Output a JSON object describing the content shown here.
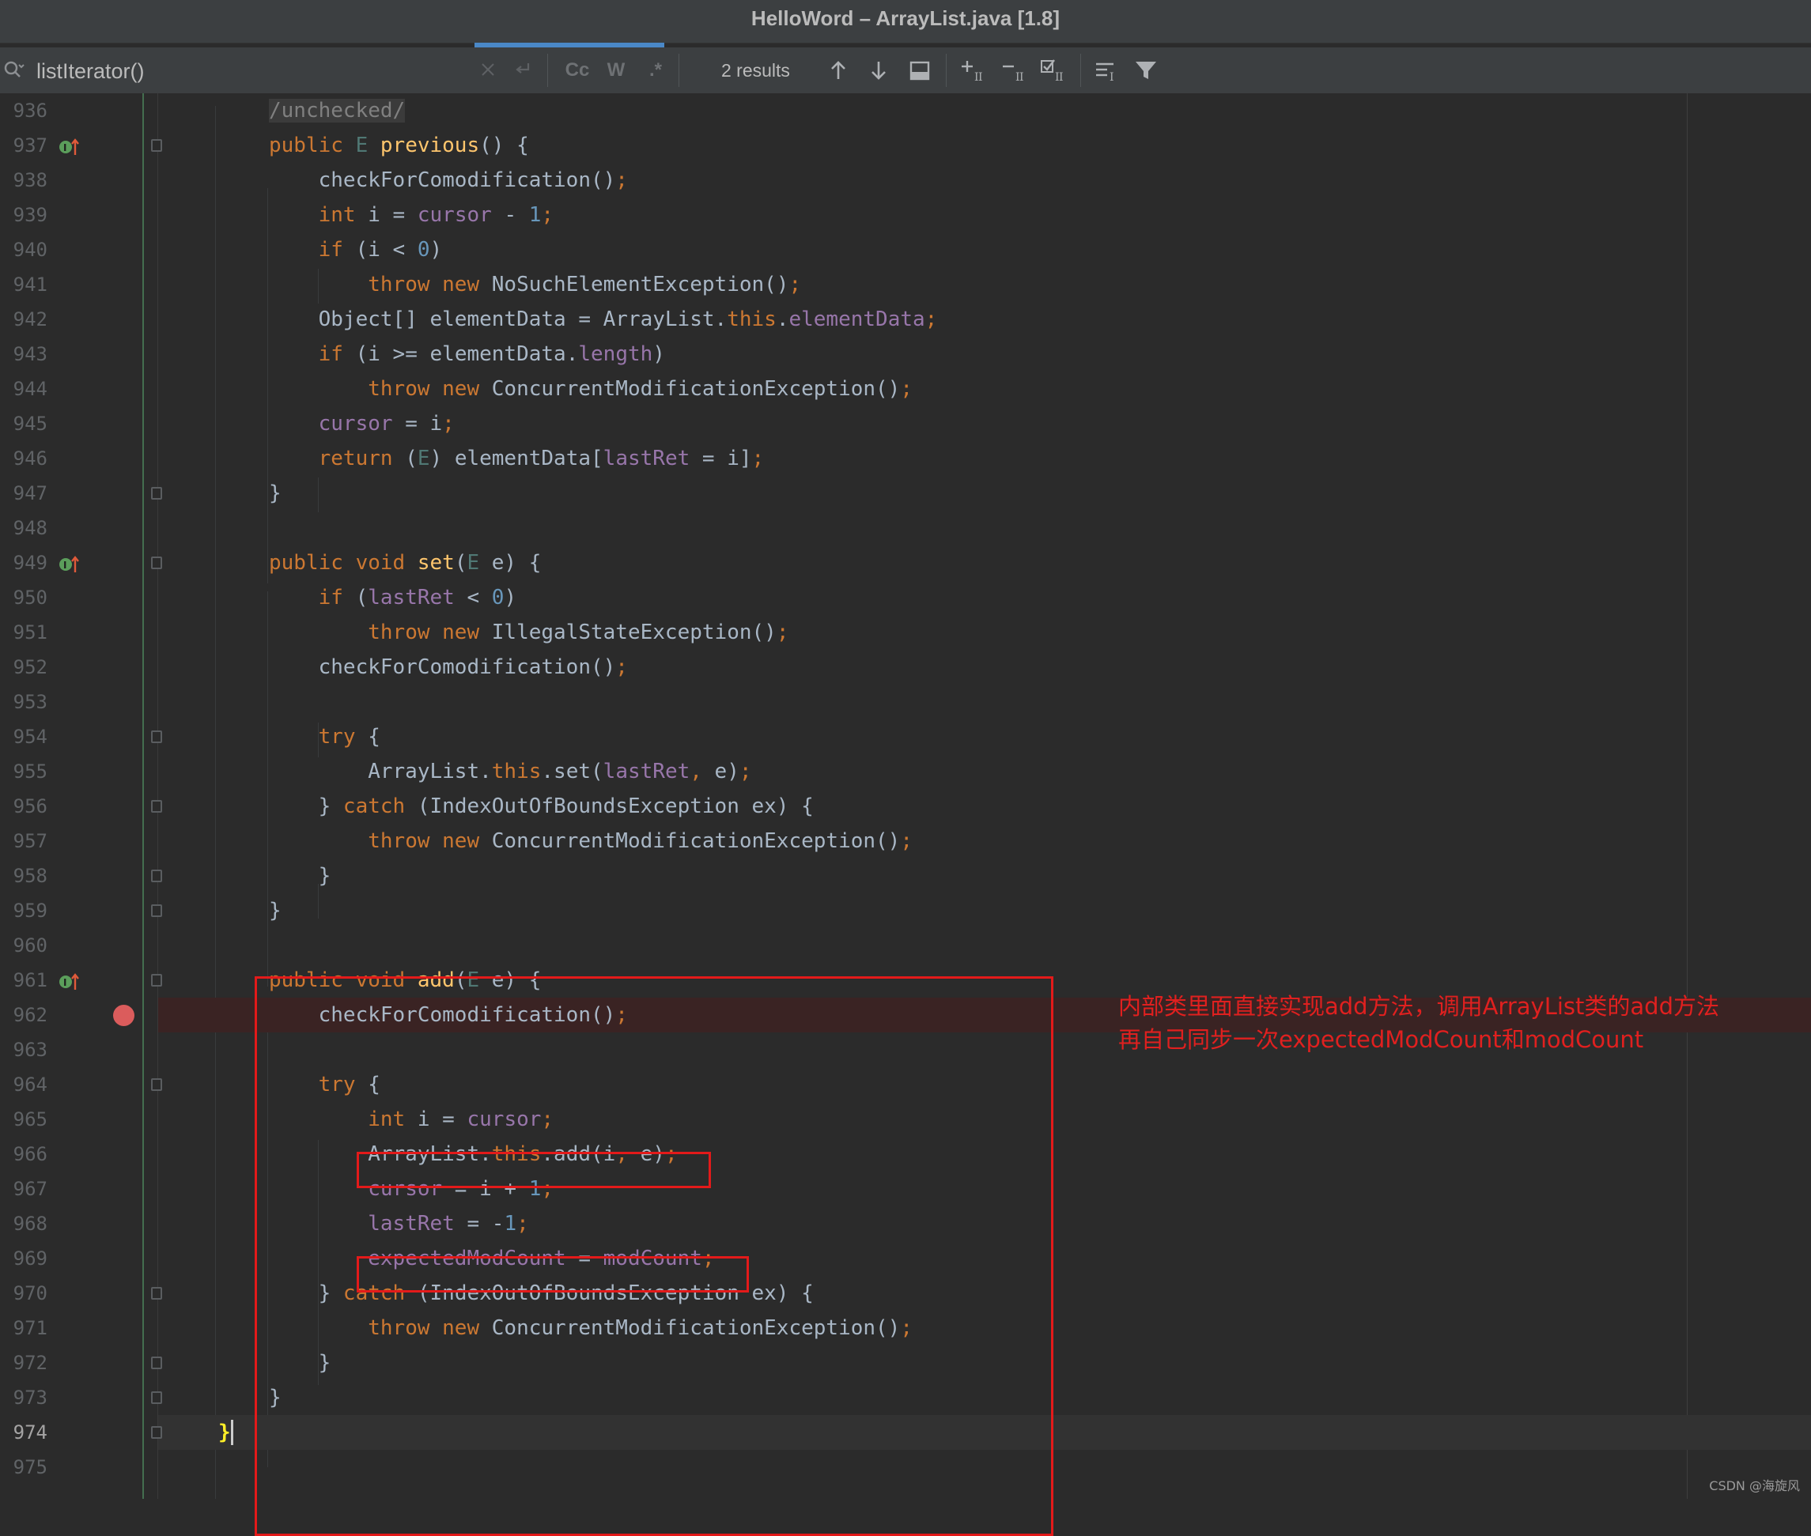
{
  "window": {
    "title": "HelloWord – ArrayList.java [1.8]"
  },
  "find_bar": {
    "query": "listIterator()",
    "match_case_label": "Cc",
    "words_label": "W",
    "regex_label": ".*",
    "results": "2 results"
  },
  "code_lines": [
    {
      "n": "936",
      "t": "/unchecked/"
    },
    {
      "n": "937",
      "t": "public E previous() {"
    },
    {
      "n": "938",
      "t": "checkForComodification();"
    },
    {
      "n": "939",
      "t": "int i = cursor - 1;"
    },
    {
      "n": "940",
      "t": "if (i < 0)"
    },
    {
      "n": "941",
      "t": "throw new NoSuchElementException();"
    },
    {
      "n": "942",
      "t": "Object[] elementData = ArrayList.this.elementData;"
    },
    {
      "n": "943",
      "t": "if (i >= elementData.length)"
    },
    {
      "n": "944",
      "t": "throw new ConcurrentModificationException();"
    },
    {
      "n": "945",
      "t": "cursor = i;"
    },
    {
      "n": "946",
      "t": "return (E) elementData[lastRet = i];"
    },
    {
      "n": "947",
      "t": "}"
    },
    {
      "n": "948",
      "t": ""
    },
    {
      "n": "949",
      "t": "public void set(E e) {"
    },
    {
      "n": "950",
      "t": "if (lastRet < 0)"
    },
    {
      "n": "951",
      "t": "throw new IllegalStateException();"
    },
    {
      "n": "952",
      "t": "checkForComodification();"
    },
    {
      "n": "953",
      "t": ""
    },
    {
      "n": "954",
      "t": "try {"
    },
    {
      "n": "955",
      "t": "ArrayList.this.set(lastRet, e);"
    },
    {
      "n": "956",
      "t": "} catch (IndexOutOfBoundsException ex) {"
    },
    {
      "n": "957",
      "t": "throw new ConcurrentModificationException();"
    },
    {
      "n": "958",
      "t": "}"
    },
    {
      "n": "959",
      "t": "}"
    },
    {
      "n": "960",
      "t": ""
    },
    {
      "n": "961",
      "t": "public void add(E e) {"
    },
    {
      "n": "962",
      "t": "checkForComodification();"
    },
    {
      "n": "963",
      "t": ""
    },
    {
      "n": "964",
      "t": "try {"
    },
    {
      "n": "965",
      "t": "int i = cursor;"
    },
    {
      "n": "966",
      "t": "ArrayList.this.add(i, e);"
    },
    {
      "n": "967",
      "t": "cursor = i + 1;"
    },
    {
      "n": "968",
      "t": "lastRet = -1;"
    },
    {
      "n": "969",
      "t": "expectedModCount = modCount;"
    },
    {
      "n": "970",
      "t": "} catch (IndexOutOfBoundsException ex) {"
    },
    {
      "n": "971",
      "t": "throw new ConcurrentModificationException();"
    },
    {
      "n": "972",
      "t": "}"
    },
    {
      "n": "973",
      "t": "}"
    },
    {
      "n": "974",
      "t": "}"
    },
    {
      "n": "975",
      "t": ""
    }
  ],
  "annotation": {
    "line1": "内部类里面直接实现add方法，调用ArrayList类的add方法",
    "line2": "再自己同步一次expectedModCount和modCount"
  },
  "watermark": "CSDN @海旋风",
  "colors": {
    "keyword": "#cc7832",
    "method": "#ffc66d",
    "number": "#6897bb",
    "field": "#9876aa",
    "annotation_red": "#e31a1a",
    "breakpoint": "#db5c5c"
  }
}
